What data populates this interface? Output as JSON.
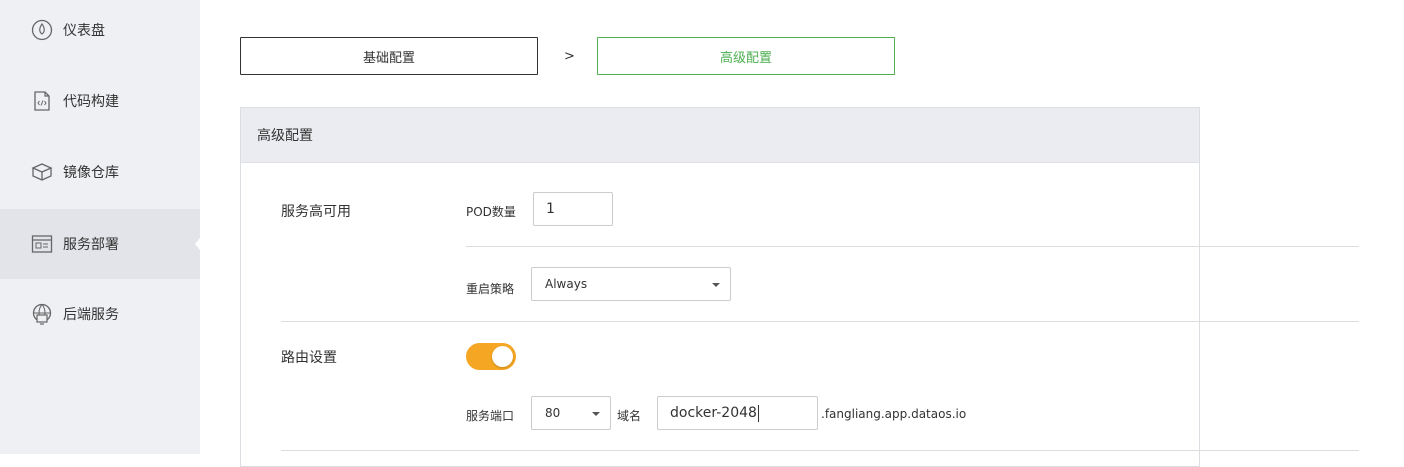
{
  "sidebar": {
    "items": [
      {
        "label": "仪表盘",
        "icon": "dashboard-icon"
      },
      {
        "label": "代码构建",
        "icon": "code-file-icon"
      },
      {
        "label": "镜像仓库",
        "icon": "box-icon"
      },
      {
        "label": "服务部署",
        "icon": "deploy-window-icon",
        "active": true
      },
      {
        "label": "后端服务",
        "icon": "globe-monitor-icon"
      }
    ]
  },
  "steps": {
    "basic": "基础配置",
    "separator": ">",
    "advanced": "高级配置"
  },
  "panel": {
    "title": "高级配置",
    "ha": {
      "title": "服务高可用",
      "pod_label": "POD数量",
      "pod_value": "1",
      "restart_label": "重启策略",
      "restart_value": "Always"
    },
    "route": {
      "title": "路由设置",
      "enabled": true,
      "port_label": "服务端口",
      "port_value": "80",
      "domain_label": "域名",
      "domain_value": "docker-2048",
      "domain_suffix": ".fangliang.app.dataos.io"
    }
  },
  "colors": {
    "accent_green": "#4caf50",
    "toggle_orange": "#f5a623",
    "sidebar_bg": "#eff0f4"
  }
}
